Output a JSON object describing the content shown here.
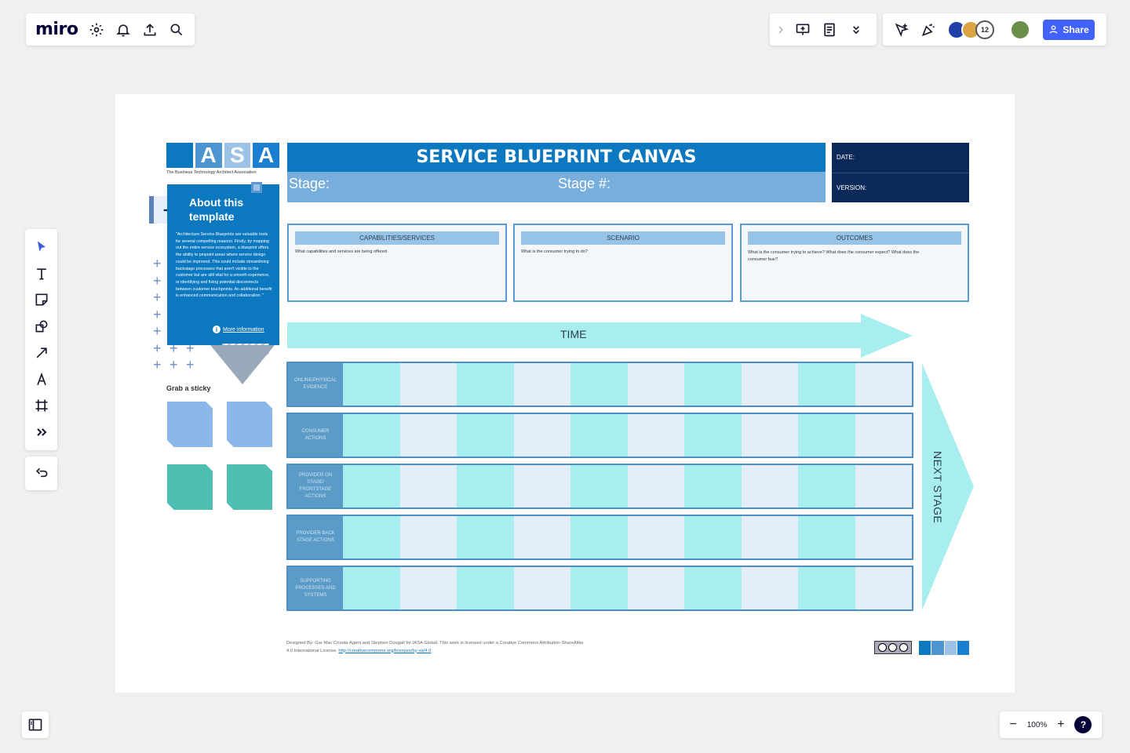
{
  "app": {
    "logo": "miro"
  },
  "toolbar_right": {
    "share_label": "Share",
    "collaborator_count": "12"
  },
  "zoom": {
    "level": "100%",
    "help_label": "?"
  },
  "board": {
    "iasa": {
      "letters": [
        "I",
        "A",
        "S",
        "A"
      ],
      "tagline": "The Business Technology Architect Association"
    },
    "title": "SERVICE BLUEPRINT CANVAS",
    "stage_label": "Stage:",
    "stage_num_label": "Stage #:",
    "date_label": "DATE:",
    "version_label": "VERSION:",
    "about": {
      "title_line1": "About this",
      "title_line2": "template",
      "body": "\"Architecture Service Blueprints are valuable tools for several compelling reasons. Firstly, by mapping out the entire service ecosystem, a blueprint offers the ability to pinpoint areas where service design could be improved. This could include streamlining backstage processes that aren't visible to the customer but are still vital for a smooth experience, or identifying and fixing potential disconnects between customer touchpoints. An additional benefit is enhanced communication and collaboration. \"",
      "link": "More information"
    },
    "grab_sticky": "Grab a sticky",
    "boxes": [
      {
        "header": "CAPABILITIES/SERVICES",
        "text": "What capabilities and services are being offered"
      },
      {
        "header": "SCENARIO",
        "text": "What is the consumer trying to do?"
      },
      {
        "header": "OUTCOMES",
        "text": "What is the consumer trying to achieve? What does the consumer expect? What does the consumer fear?"
      }
    ],
    "time_label": "TIME",
    "next_stage_label": "NEXT STAGE",
    "lanes": [
      "ONLINE/PHYSICAL EVIDENCE",
      "CONSUMER ACTIONS",
      "PROVIDER ON STAGE/ FRONTSTAGE ACTIONS",
      "PROVIDER BACK STAGE ACTIONS",
      "SUPPORTING PROCESSES AND SYSTEMS"
    ],
    "footer_text": "Designed By: Gar Mac Críosta Agent and Stephen Dougall for IASA Global. This work is licensed under a Creative Commons Attribution-ShareAlike 4.0 International License.",
    "footer_link": "http://creativecommons.org/licenses/by-sa/4.0"
  },
  "colors": {
    "accent": "#4262ff",
    "iasa_blue": "#0c78c0",
    "navy": "#0b2a5a",
    "cyan": "#a8eeee"
  }
}
